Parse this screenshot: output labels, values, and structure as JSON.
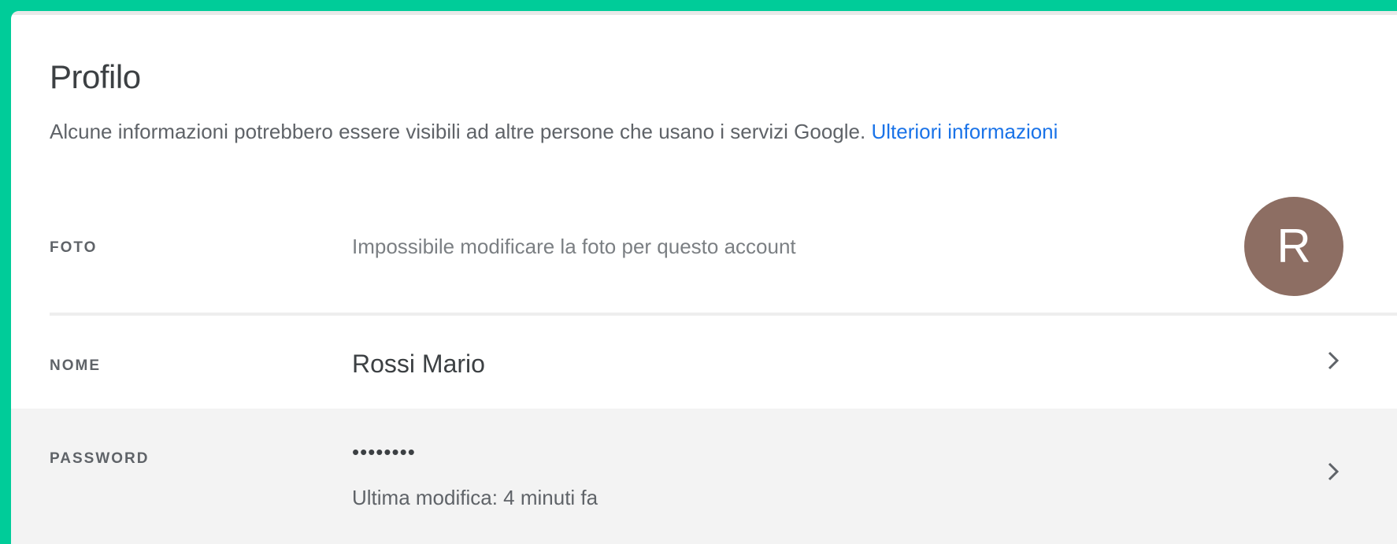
{
  "profile": {
    "title": "Profilo",
    "subtitle": "Alcune informazioni potrebbero essere visibili ad altre persone che usano i servizi Google.",
    "learn_more": "Ulteriori informazioni"
  },
  "rows": {
    "photo": {
      "label": "FOTO",
      "value": "Impossibile modificare la foto per questo account",
      "avatar_letter": "R",
      "avatar_color": "#8d6e63"
    },
    "name": {
      "label": "NOME",
      "value": "Rossi Mario"
    },
    "password": {
      "label": "PASSWORD",
      "value": "••••••••",
      "last_modified": "Ultima modifica: 4 minuti fa"
    }
  },
  "colors": {
    "frame_border": "#00cc99",
    "link": "#1a73e8",
    "highlight_row": "#f3f3f3"
  },
  "icons": {
    "chevron": "chevron-right-icon"
  }
}
